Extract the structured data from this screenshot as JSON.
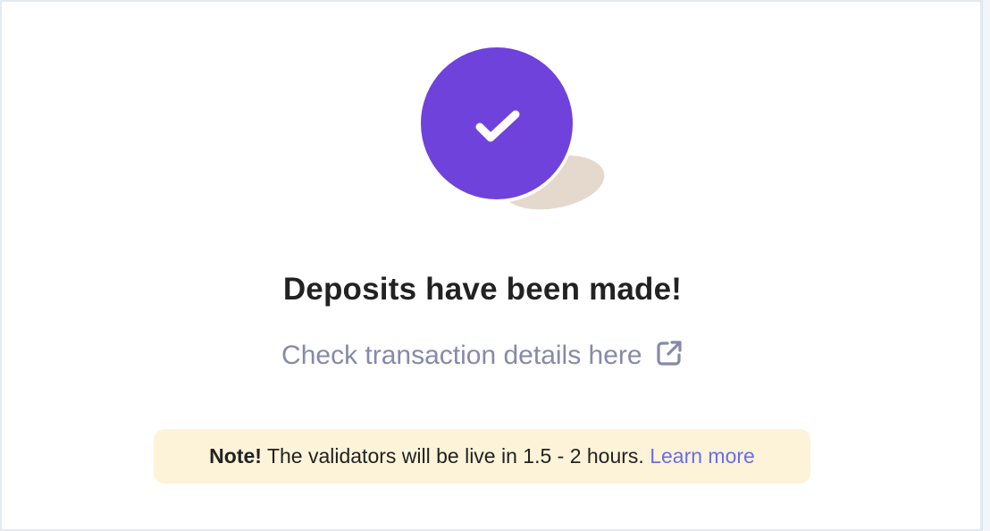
{
  "colors": {
    "accent_purple": "#6f42dc",
    "shadow_tan": "#e5d8cd",
    "title_text": "#222222",
    "link_gray": "#868aa8",
    "note_background": "#fdf3d8",
    "learn_more_link": "#6a6ee8"
  },
  "success": {
    "icon": "check-circle-icon",
    "title": "Deposits have been made!"
  },
  "details": {
    "link_text": "Check transaction details here",
    "icon": "external-link-icon"
  },
  "note": {
    "label": "Note!",
    "message": "The validators will be live in 1.5 - 2 hours.",
    "learn_more": "Learn more"
  }
}
